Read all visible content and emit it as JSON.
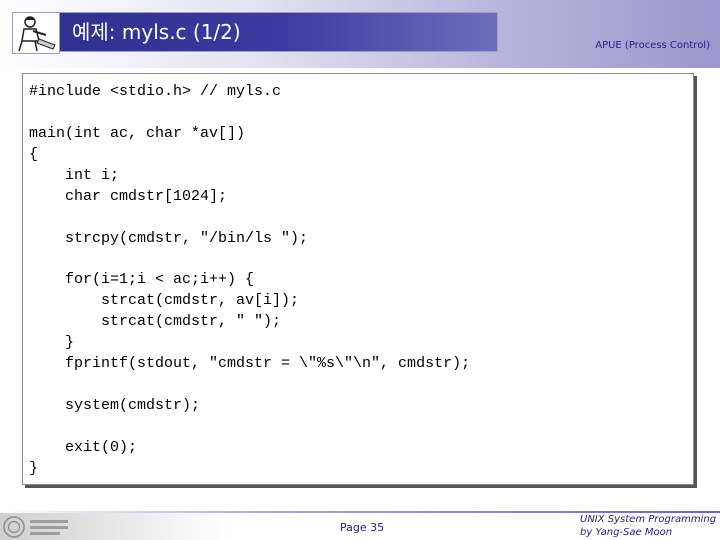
{
  "header": {
    "title": "예제: myls.c (1/2)",
    "course": "APUE (Process Control)"
  },
  "code": {
    "lines": [
      "#include <stdio.h> // myls.c",
      "",
      "main(int ac, char *av[])",
      "{",
      "    int i;",
      "    char cmdstr[1024];",
      "",
      "    strcpy(cmdstr, \"/bin/ls \");",
      "",
      "    for(i=1;i < ac;i++) {",
      "        strcat(cmdstr, av[i]);",
      "        strcat(cmdstr, \" \");",
      "    }",
      "    fprintf(stdout, \"cmdstr = \\\"%s\\\"\\n\", cmdstr);",
      "",
      "    system(cmdstr);",
      "",
      "    exit(0);",
      "}"
    ]
  },
  "footer": {
    "page": "Page 35",
    "credit_line1": "UNIX System Programming",
    "credit_line2": "by Yang-Sae Moon"
  },
  "icons": {
    "header_logo": "person-at-desk-icon",
    "footer_logo": "university-seal-icon"
  },
  "colors": {
    "title_bar": "#2e2e8e",
    "accent_text": "#22228a"
  }
}
